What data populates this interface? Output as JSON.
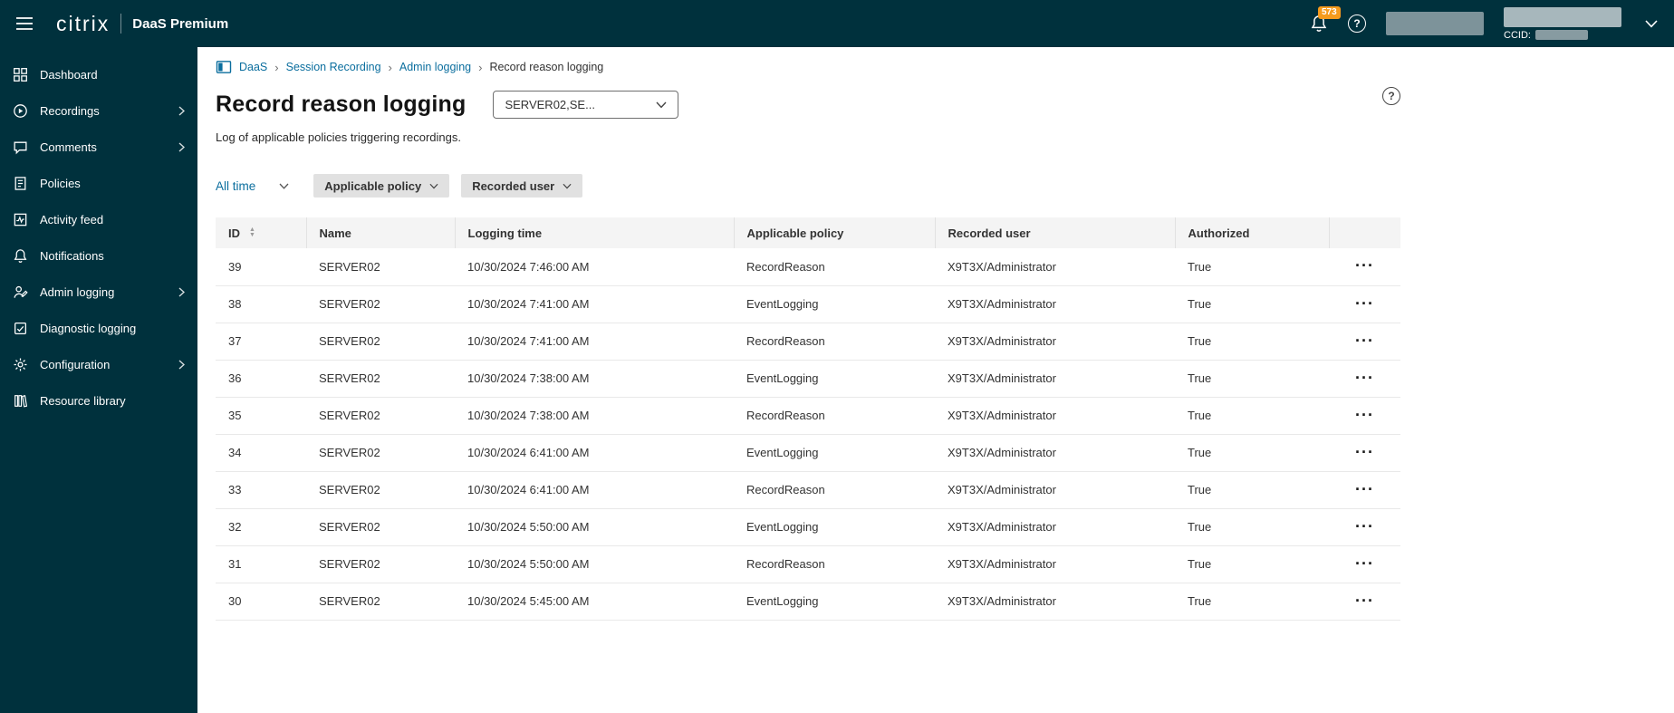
{
  "header": {
    "brand": "citrix",
    "product": "DaaS Premium",
    "notification_badge": "573",
    "help_glyph": "?",
    "ccid_label": "CCID:"
  },
  "sidebar": {
    "items": [
      {
        "label": "Dashboard",
        "icon": "dashboard-icon",
        "expandable": false
      },
      {
        "label": "Recordings",
        "icon": "recordings-icon",
        "expandable": true
      },
      {
        "label": "Comments",
        "icon": "comments-icon",
        "expandable": true
      },
      {
        "label": "Policies",
        "icon": "policies-icon",
        "expandable": false
      },
      {
        "label": "Activity feed",
        "icon": "activity-feed-icon",
        "expandable": false
      },
      {
        "label": "Notifications",
        "icon": "notifications-icon",
        "expandable": false
      },
      {
        "label": "Admin logging",
        "icon": "admin-logging-icon",
        "expandable": true
      },
      {
        "label": "Diagnostic logging",
        "icon": "diagnostic-logging-icon",
        "expandable": false
      },
      {
        "label": "Configuration",
        "icon": "configuration-icon",
        "expandable": true
      },
      {
        "label": "Resource library",
        "icon": "resource-library-icon",
        "expandable": false
      }
    ]
  },
  "breadcrumb": {
    "links": [
      "DaaS",
      "Session Recording",
      "Admin logging"
    ],
    "current": "Record reason logging"
  },
  "page": {
    "title": "Record reason logging",
    "server_selector": "SERVER02,SE...",
    "subtitle": "Log of applicable policies triggering recordings."
  },
  "filters": {
    "time_range": "All time",
    "applicable_policy": "Applicable policy",
    "recorded_user": "Recorded user"
  },
  "table": {
    "columns": [
      "ID",
      "Name",
      "Logging time",
      "Applicable policy",
      "Recorded user",
      "Authorized"
    ],
    "rows": [
      {
        "id": "39",
        "name": "SERVER02",
        "time": "10/30/2024 7:46:00 AM",
        "policy": "RecordReason",
        "user": "X9T3X/Administrator",
        "authorized": "True"
      },
      {
        "id": "38",
        "name": "SERVER02",
        "time": "10/30/2024 7:41:00 AM",
        "policy": "EventLogging",
        "user": "X9T3X/Administrator",
        "authorized": "True"
      },
      {
        "id": "37",
        "name": "SERVER02",
        "time": "10/30/2024 7:41:00 AM",
        "policy": "RecordReason",
        "user": "X9T3X/Administrator",
        "authorized": "True"
      },
      {
        "id": "36",
        "name": "SERVER02",
        "time": "10/30/2024 7:38:00 AM",
        "policy": "EventLogging",
        "user": "X9T3X/Administrator",
        "authorized": "True"
      },
      {
        "id": "35",
        "name": "SERVER02",
        "time": "10/30/2024 7:38:00 AM",
        "policy": "RecordReason",
        "user": "X9T3X/Administrator",
        "authorized": "True"
      },
      {
        "id": "34",
        "name": "SERVER02",
        "time": "10/30/2024 6:41:00 AM",
        "policy": "EventLogging",
        "user": "X9T3X/Administrator",
        "authorized": "True"
      },
      {
        "id": "33",
        "name": "SERVER02",
        "time": "10/30/2024 6:41:00 AM",
        "policy": "RecordReason",
        "user": "X9T3X/Administrator",
        "authorized": "True"
      },
      {
        "id": "32",
        "name": "SERVER02",
        "time": "10/30/2024 5:50:00 AM",
        "policy": "EventLogging",
        "user": "X9T3X/Administrator",
        "authorized": "True"
      },
      {
        "id": "31",
        "name": "SERVER02",
        "time": "10/30/2024 5:50:00 AM",
        "policy": "RecordReason",
        "user": "X9T3X/Administrator",
        "authorized": "True"
      },
      {
        "id": "30",
        "name": "SERVER02",
        "time": "10/30/2024 5:45:00 AM",
        "policy": "EventLogging",
        "user": "X9T3X/Administrator",
        "authorized": "True"
      }
    ]
  },
  "glyphs": {
    "sort_asc": "▲",
    "sort_desc": "▼",
    "ellipsis": "···",
    "breadcrumb_separator": "›"
  },
  "colors": {
    "header_bg": "#00313d",
    "sidebar_bg": "#00313d",
    "link": "#0b6e9e",
    "badge": "#f59b1d",
    "pill_bg": "#e1e1e1"
  }
}
